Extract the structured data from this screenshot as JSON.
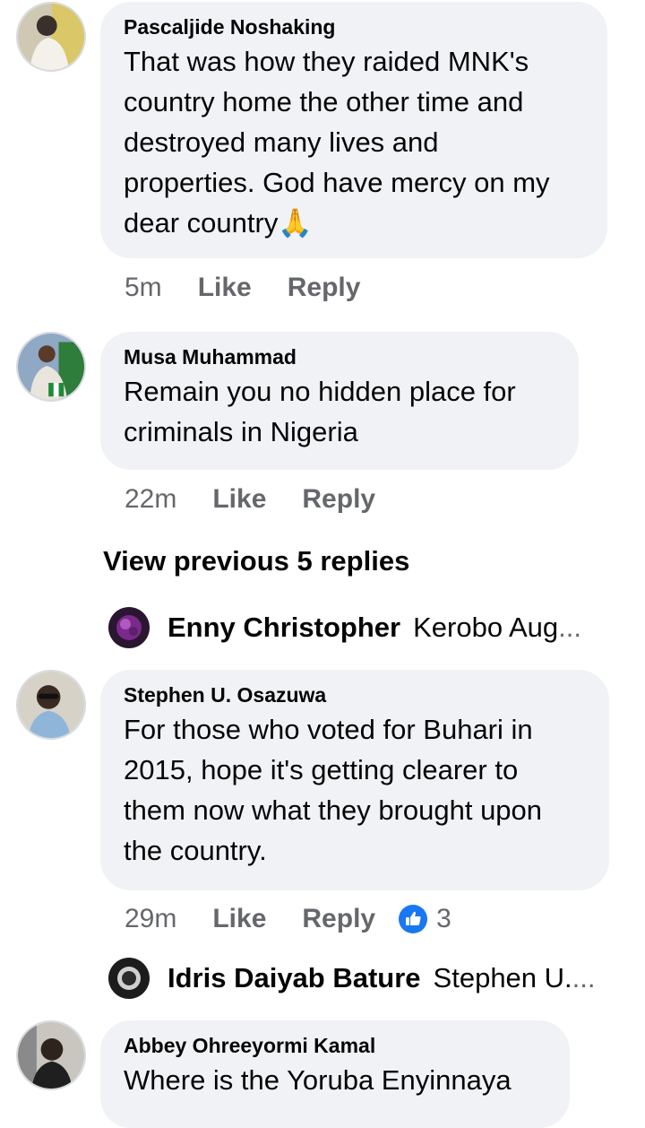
{
  "comments": [
    {
      "author": "Pascaljide Noshaking",
      "lines": [
        "That was how they raided MNK's",
        "country home the other time and",
        "destroyed many lives and",
        "properties. God have mercy on my",
        "dear country"
      ],
      "emoji": "🙏",
      "time": "5m",
      "like": "Like",
      "reply": "Reply"
    },
    {
      "author": "Musa Muhammad",
      "lines": [
        "Remain you  no hidden place for",
        "criminals in Nigeria"
      ],
      "time": "22m",
      "like": "Like",
      "reply": "Reply"
    },
    {
      "author": "Stephen U. Osazuwa",
      "lines": [
        "For those who voted for Buhari in",
        "2015, hope it's getting clearer to",
        "them now what they brought upon",
        "the country."
      ],
      "time": "29m",
      "like": "Like",
      "reply": "Reply",
      "reaction_count": "3"
    },
    {
      "author": "Abbey Ohreeyormi Kamal",
      "lines": [
        "Where is the Yoruba Enyinnaya"
      ]
    }
  ],
  "view_previous": "View previous 5 replies",
  "reply_previews": [
    {
      "name": "Enny Christopher",
      "text": "Kerobo Aug",
      "ellipsis": "..."
    },
    {
      "name": "Idris Daiyab Bature",
      "text": "Stephen U.",
      "ellipsis": "..."
    }
  ],
  "colors": {
    "bubble": "#f0f2f5",
    "meta": "#65676b",
    "like_blue": "#1877f2"
  }
}
